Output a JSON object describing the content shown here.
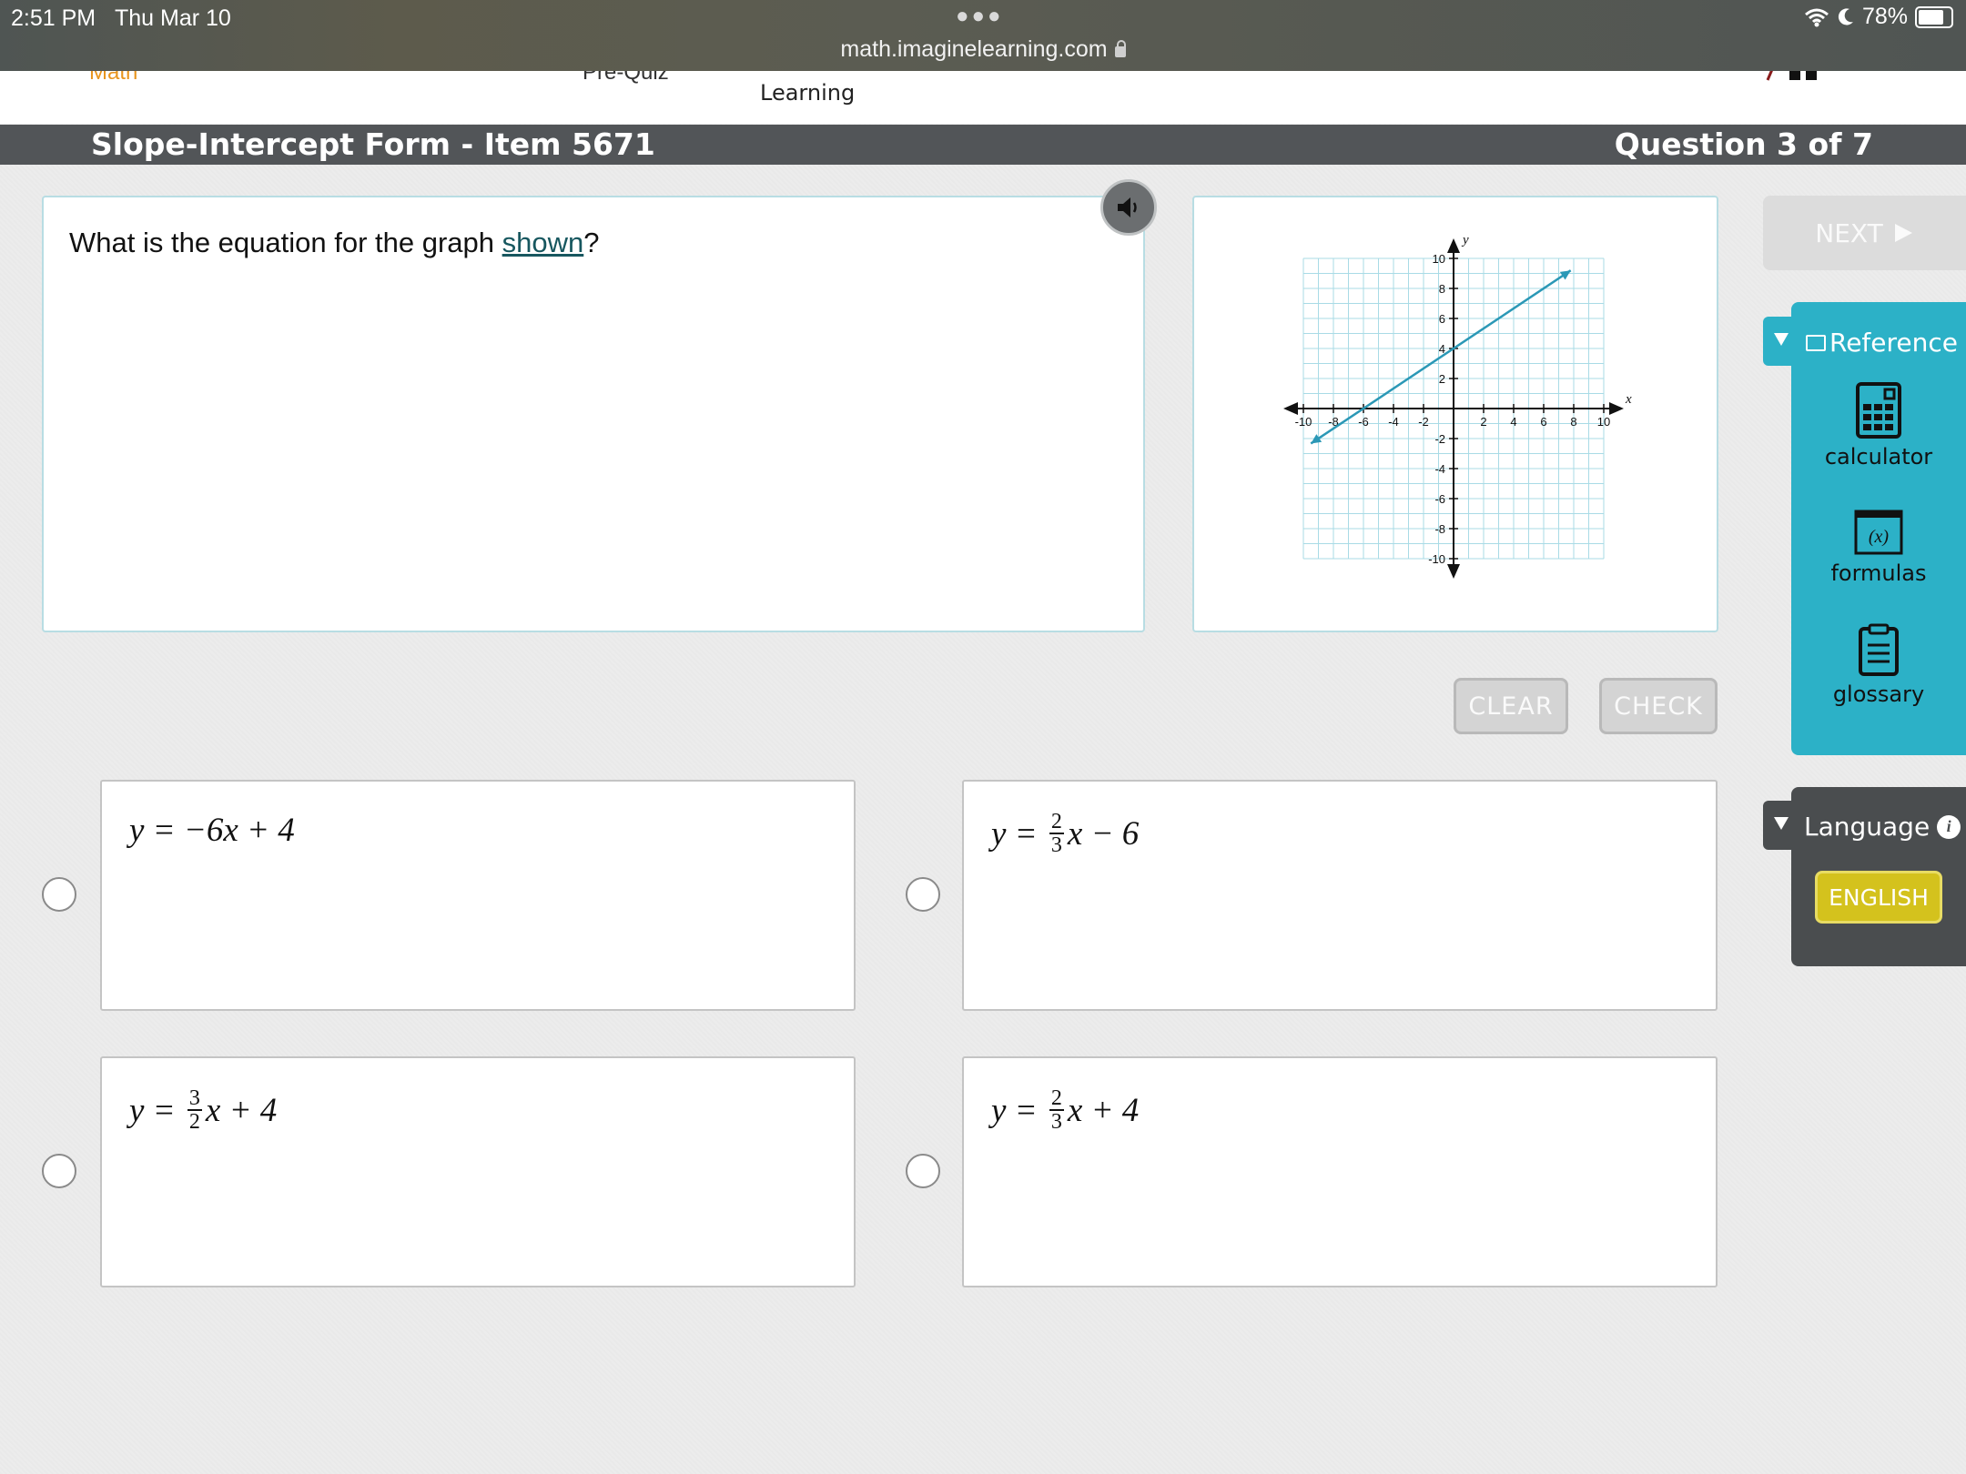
{
  "status_bar": {
    "time": "2:51 PM",
    "date": "Thu Mar 10",
    "url": "math.imaginelearning.com",
    "battery": "78%"
  },
  "top_nav": {
    "math_label": "Math",
    "prequiz_label": "Pre-Quiz",
    "learning_label": "Learning"
  },
  "title_bar": {
    "item_title": "Slope-Intercept Form - Item 5671",
    "question_count": "Question 3 of 7"
  },
  "question": {
    "text_before": "What is the equation for the graph ",
    "link_text": "shown",
    "text_after": "?"
  },
  "graph": {
    "axis_x_label": "x",
    "axis_y_label": "y",
    "x_tick_labels": [
      "-10",
      "-8",
      "-6",
      "-4",
      "-2",
      "2",
      "4",
      "6",
      "8",
      "10"
    ],
    "y_tick_labels": [
      "10",
      "8",
      "6",
      "4",
      "2",
      "-2",
      "-4",
      "-6",
      "-8",
      "-10"
    ],
    "x_range": [
      -10,
      10
    ],
    "y_range": [
      -10,
      10
    ],
    "line_points": [
      [
        -9.5,
        -2.33
      ],
      [
        7.8,
        9.2
      ]
    ],
    "line_color": "#2b98b6"
  },
  "buttons": {
    "clear_label": "CLEAR",
    "check_label": "CHECK",
    "next_label": "NEXT"
  },
  "options": [
    {
      "id": "a",
      "prefix": "y = −6x + 4"
    },
    {
      "id": "b",
      "lhs": "y = ",
      "num": "2",
      "den": "3",
      "rhs": "x − 6"
    },
    {
      "id": "c",
      "lhs": "y = ",
      "num": "3",
      "den": "2",
      "rhs": "x + 4"
    },
    {
      "id": "d",
      "lhs": "y = ",
      "num": "2",
      "den": "3",
      "rhs": "x + 4"
    }
  ],
  "reference_panel": {
    "header": "Reference",
    "tools": {
      "calculator": "calculator",
      "formulas": "formulas",
      "glossary": "glossary"
    },
    "formulas_icon_text": "(x)"
  },
  "language_panel": {
    "header": "Language",
    "selected": "ENGLISH"
  },
  "colors": {
    "accent_teal": "#2cb1c7",
    "title_bar": "#525558",
    "language_button": "#d4c21d"
  }
}
